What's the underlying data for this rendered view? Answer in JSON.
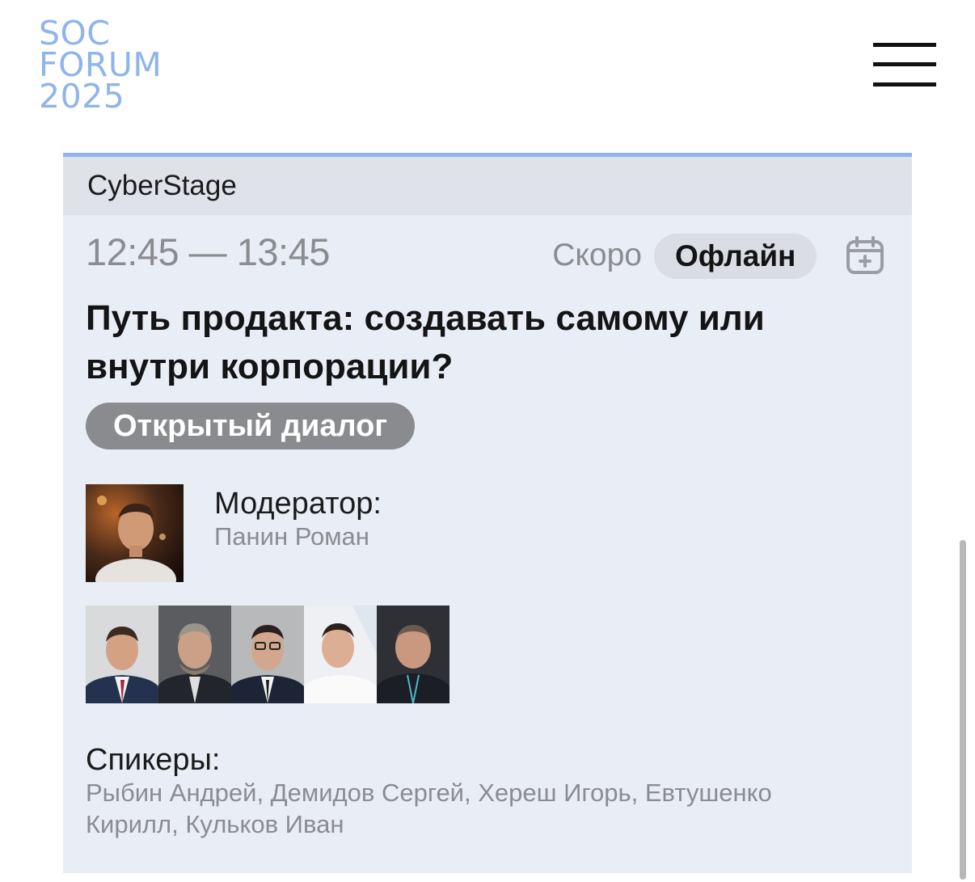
{
  "logo": {
    "line1": "SOC",
    "line2": "FORUM",
    "line3": "2025"
  },
  "header": {
    "menu_icon": "hamburger-menu-icon"
  },
  "session": {
    "stage": "CyberStage",
    "time": "12:45 — 13:45",
    "status": "Скоро",
    "format": "Офлайн",
    "calendar_icon": "add-to-calendar-icon",
    "title": "Путь продакта: создавать самому или внутри корпорации?",
    "tag": "Открытый диалог",
    "moderator_label": "Модератор:",
    "moderator_name": "Панин Роман",
    "speakers_label": "Спикеры:",
    "speakers_names": "Рыбин Андрей, Демидов Сергей, Хереш Игорь, Евтушенко Кирилл, Кульков Иван"
  },
  "colors": {
    "accent": "#8fb4ec",
    "card_bg": "#e9edf5",
    "stage_bg": "#dfe2e9",
    "tag_bg": "#8a8b8e",
    "muted_text": "#8a8c90"
  }
}
